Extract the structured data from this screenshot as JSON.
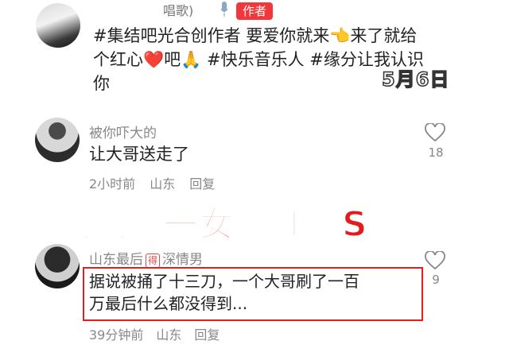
{
  "comment_top": {
    "username_partial": "唱歌)",
    "author_badge": "作者",
    "text_line1": "#集结吧光合创作者 要爱你就来👈来了就给",
    "text_line2_a": "个红心",
    "text_line2_heart": "❤️",
    "text_line2_b": "吧🙏 #快乐音乐人 #缘分让我认识",
    "text_line3": "你",
    "date_stamp": "5月6日"
  },
  "comment_2": {
    "username": "被你吓大的",
    "text": "让大哥送走了",
    "time": "2小时前",
    "location": "山东",
    "reply_label": "回复",
    "likes": "18"
  },
  "headline": "凤凰岭一女网红被S害",
  "comment_3": {
    "username": "山东最后",
    "award_badge": "得",
    "username_suffix": "深情男",
    "text_line1": "据说被捅了十三刀，一个大哥刷了一百",
    "text_line2": "万最后什么都没得到...",
    "time": "39分钟前",
    "location": "山东",
    "reply_label": "回复",
    "likes": "9"
  },
  "colors": {
    "accent_red": "#f1373b",
    "headline_red": "#e41b1b",
    "meta_gray": "#888888"
  }
}
